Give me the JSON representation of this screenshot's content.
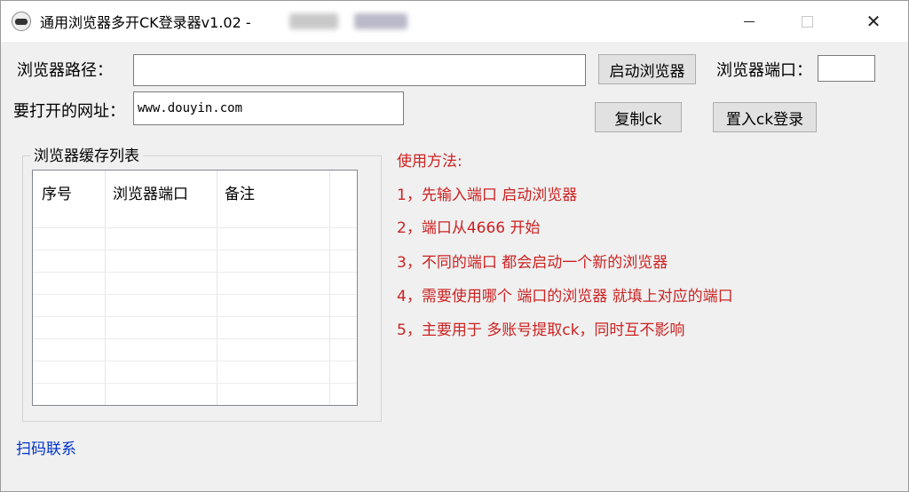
{
  "window": {
    "title": "通用浏览器多开CK登录器v1.02 -",
    "minimize_icon": "minimize-icon",
    "maximize_icon": "maximize-icon",
    "close_icon": "close-icon",
    "close_glyph": "✕"
  },
  "form": {
    "browser_path_label": "浏览器路径：",
    "browser_path_value": "",
    "launch_button": "启动浏览器",
    "port_label": "浏览器端口：",
    "port_value": "",
    "url_label": "要打开的网址：",
    "url_value": "www.douyin.com",
    "copy_button": "复制ck",
    "import_button": "置入ck登录"
  },
  "cache_list": {
    "group_title": "浏览器缓存列表",
    "columns": [
      "序号",
      "浏览器端口",
      "备注"
    ],
    "rows": []
  },
  "instructions": {
    "title": "使用方法:",
    "items": [
      "1，先输入端口 启动浏览器",
      "2，端口从4666 开始",
      "3，不同的端口 都会启动一个新的浏览器",
      "4，需要使用哪个 端口的浏览器   就填上对应的端口",
      "5，主要用于 多账号提取ck，同时互不影响"
    ]
  },
  "footer": {
    "contact_link": "扫码联系"
  },
  "colors": {
    "instruction_text": "#cc2222",
    "link_text": "#0033cc",
    "window_bg": "#f0f0f0"
  }
}
